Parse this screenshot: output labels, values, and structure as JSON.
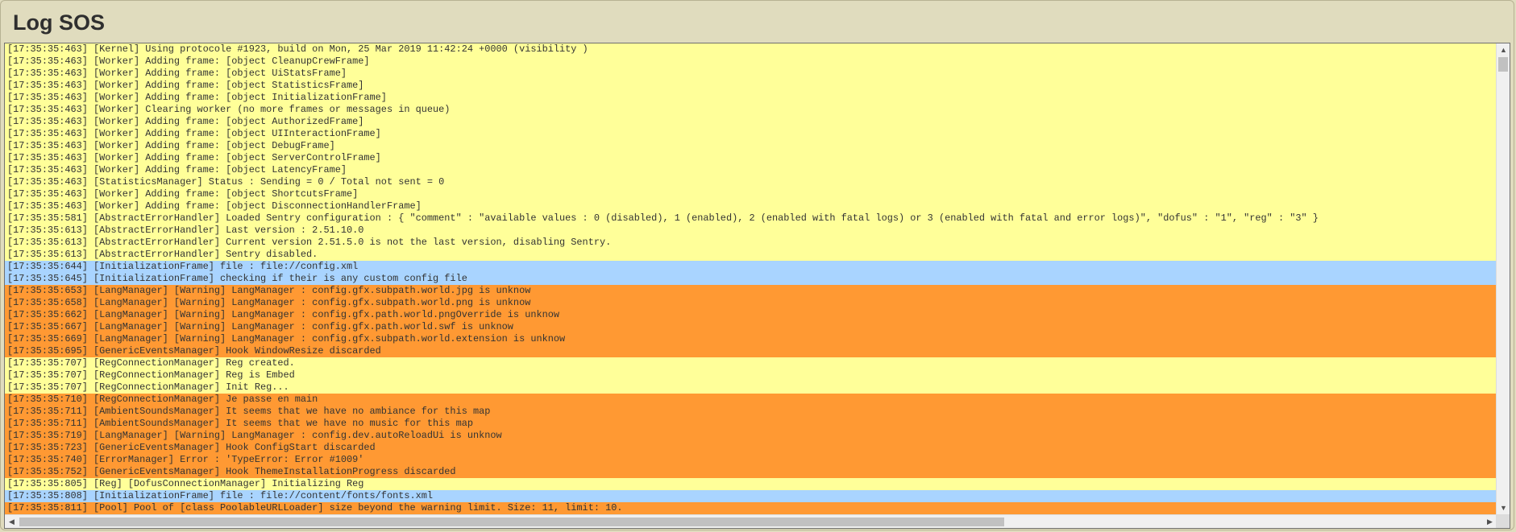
{
  "window": {
    "title": "Log SOS"
  },
  "colors": {
    "info": "#ffff99",
    "debug": "#a9d4ff",
    "warn": "#ff9933",
    "background": "#e0dcbe"
  },
  "scroll": {
    "vertical_up_icon": "triangle-up-icon",
    "vertical_down_icon": "triangle-down-icon",
    "horizontal_left_icon": "triangle-left-icon",
    "horizontal_right_icon": "triangle-right-icon",
    "up_glyph": "▲",
    "down_glyph": "▼",
    "left_glyph": "◀",
    "right_glyph": "▶"
  },
  "log_lines": [
    {
      "level": "info",
      "text": "[17:35:35:463] [Kernel] Using protocole #1923, build on Mon, 25 Mar 2019 11:42:24 +0000 (visibility )"
    },
    {
      "level": "info",
      "text": "[17:35:35:463] [Worker] Adding frame: [object CleanupCrewFrame]"
    },
    {
      "level": "info",
      "text": "[17:35:35:463] [Worker] Adding frame: [object UiStatsFrame]"
    },
    {
      "level": "info",
      "text": "[17:35:35:463] [Worker] Adding frame: [object StatisticsFrame]"
    },
    {
      "level": "info",
      "text": "[17:35:35:463] [Worker] Adding frame: [object InitializationFrame]"
    },
    {
      "level": "info",
      "text": "[17:35:35:463] [Worker] Clearing worker (no more frames or messages in queue)"
    },
    {
      "level": "info",
      "text": "[17:35:35:463] [Worker] Adding frame: [object AuthorizedFrame]"
    },
    {
      "level": "info",
      "text": "[17:35:35:463] [Worker] Adding frame: [object UIInteractionFrame]"
    },
    {
      "level": "info",
      "text": "[17:35:35:463] [Worker] Adding frame: [object DebugFrame]"
    },
    {
      "level": "info",
      "text": "[17:35:35:463] [Worker] Adding frame: [object ServerControlFrame]"
    },
    {
      "level": "info",
      "text": "[17:35:35:463] [Worker] Adding frame: [object LatencyFrame]"
    },
    {
      "level": "info",
      "text": "[17:35:35:463] [StatisticsManager] Status : Sending = 0 / Total not sent = 0"
    },
    {
      "level": "info",
      "text": "[17:35:35:463] [Worker] Adding frame: [object ShortcutsFrame]"
    },
    {
      "level": "info",
      "text": "[17:35:35:463] [Worker] Adding frame: [object DisconnectionHandlerFrame]"
    },
    {
      "level": "info",
      "text": "[17:35:35:581] [AbstractErrorHandler] Loaded Sentry configuration : { \"comment\" : \"available values : 0 (disabled), 1 (enabled), 2 (enabled with fatal logs) or 3 (enabled with fatal and error logs)\", \"dofus\" : \"1\", \"reg\" : \"3\" }"
    },
    {
      "level": "info",
      "text": "[17:35:35:613] [AbstractErrorHandler] Last version : 2.51.10.0"
    },
    {
      "level": "info",
      "text": "[17:35:35:613] [AbstractErrorHandler] Current version 2.51.5.0 is not the last version, disabling Sentry."
    },
    {
      "level": "info",
      "text": "[17:35:35:613] [AbstractErrorHandler] Sentry disabled."
    },
    {
      "level": "debug",
      "text": "[17:35:35:644] [InitializationFrame] file : file://config.xml"
    },
    {
      "level": "debug",
      "text": "[17:35:35:645] [InitializationFrame] checking if their is any custom config file"
    },
    {
      "level": "warn",
      "text": "[17:35:35:653] [LangManager] [Warning] LangManager : config.gfx.subpath.world.jpg is unknow"
    },
    {
      "level": "warn",
      "text": "[17:35:35:658] [LangManager] [Warning] LangManager : config.gfx.subpath.world.png is unknow"
    },
    {
      "level": "warn",
      "text": "[17:35:35:662] [LangManager] [Warning] LangManager : config.gfx.path.world.pngOverride is unknow"
    },
    {
      "level": "warn",
      "text": "[17:35:35:667] [LangManager] [Warning] LangManager : config.gfx.path.world.swf is unknow"
    },
    {
      "level": "warn",
      "text": "[17:35:35:669] [LangManager] [Warning] LangManager : config.gfx.subpath.world.extension is unknow"
    },
    {
      "level": "warn",
      "text": "[17:35:35:695] [GenericEventsManager] Hook WindowResize discarded"
    },
    {
      "level": "info",
      "text": "[17:35:35:707] [RegConnectionManager] Reg created."
    },
    {
      "level": "info",
      "text": "[17:35:35:707] [RegConnectionManager] Reg is Embed"
    },
    {
      "level": "info",
      "text": "[17:35:35:707] [RegConnectionManager] Init Reg..."
    },
    {
      "level": "warn",
      "text": "[17:35:35:710] [RegConnectionManager] Je passe en main"
    },
    {
      "level": "warn",
      "text": "[17:35:35:711] [AmbientSoundsManager] It seems that we have no ambiance for this map"
    },
    {
      "level": "warn",
      "text": "[17:35:35:711] [AmbientSoundsManager] It seems that we have no music for this map"
    },
    {
      "level": "warn",
      "text": "[17:35:35:719] [LangManager] [Warning] LangManager : config.dev.autoReloadUi is unknow"
    },
    {
      "level": "warn",
      "text": "[17:35:35:723] [GenericEventsManager] Hook ConfigStart discarded"
    },
    {
      "level": "warn",
      "text": "[17:35:35:740] [ErrorManager] Error : 'TypeError: Error #1009'"
    },
    {
      "level": "warn",
      "text": "[17:35:35:752] [GenericEventsManager] Hook ThemeInstallationProgress discarded"
    },
    {
      "level": "info",
      "text": "[17:35:35:805] [Reg] [DofusConnectionManager] Initializing Reg"
    },
    {
      "level": "debug",
      "text": "[17:35:35:808] [InitializationFrame] file : file://content/fonts/fonts.xml"
    },
    {
      "level": "warn",
      "text": "[17:35:35:811] [Pool] Pool of [class PoolableURLLoader] size beyond the warning limit. Size: 11, limit: 10."
    }
  ]
}
